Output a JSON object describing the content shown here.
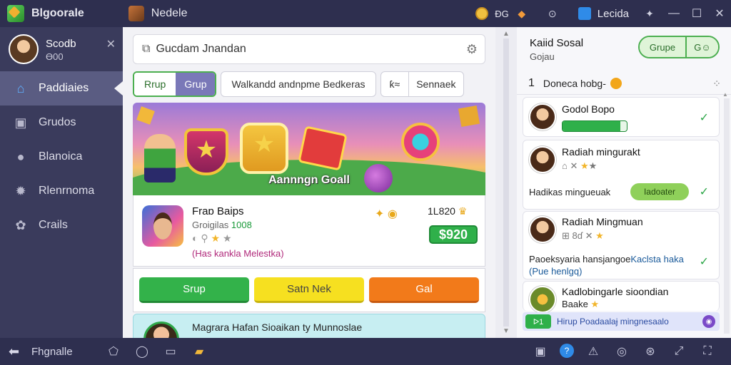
{
  "titlebar": {
    "app_title": "Blgoorale",
    "tab_title": "Nedele",
    "coin_text": "ÐG",
    "tab2_title": "Lecida",
    "icons": [
      "coin-icon",
      "diamond-icon",
      "settings-icon",
      "blue-square-icon",
      "puzzle-icon",
      "minimize-icon",
      "maximize-icon",
      "close-icon"
    ]
  },
  "sidebar": {
    "profile_name": "Scodb",
    "profile_sub": "Ɵ00",
    "items": [
      {
        "label": "Paddiaies",
        "icon": "home-icon",
        "active": true
      },
      {
        "label": "Grudos",
        "icon": "gallery-icon",
        "active": false
      },
      {
        "label": "Blanoica",
        "icon": "chat-icon",
        "active": false
      },
      {
        "label": "Rlenrnoma",
        "icon": "gear-icon",
        "active": false
      },
      {
        "label": "Crails",
        "icon": "settings-icon",
        "active": false
      }
    ]
  },
  "main": {
    "search_value": "Gucdam Jnandan",
    "chips": {
      "pair_a": "Rrup",
      "pair_b": "Grup",
      "wide": "Walkandd andnpme Bedkeras",
      "split_icon": "ƙ≈",
      "split_text": "Sennaek"
    },
    "banner_label": "Aannngn Goall",
    "game": {
      "title": "Fraɒ Baips",
      "sub_prefix": "Groigilas ",
      "sub_value": "1008",
      "stars": [
        "off",
        "on",
        "on"
      ],
      "note": "(Has kankla Melestka)",
      "count": "1L820",
      "price": "$920"
    },
    "actions": {
      "green": "Srup",
      "yellow": "Satn Nek",
      "orange": "Gal"
    },
    "promo_text": "Magrara Hafan Sioaikan ty Munnoslae"
  },
  "right": {
    "title": "Kaiid Sosal",
    "sub": "Gojau",
    "group_a": "Grupe",
    "group_b": "G",
    "head_num": "1",
    "head_text": "Doneca hobg-",
    "items": [
      {
        "name": "Godol Bopo",
        "progress": 0.9
      },
      {
        "name": "Radiah mingurakt",
        "meta": "⌂ ✕",
        "text": "Hadikas mingueuak",
        "pill": "Iadoater"
      },
      {
        "name": "Radiah Mingmuan",
        "meta": "⊞ 8ɗ ✕",
        "text_a": "Paoeksyaria hansjangoe",
        "text_b": "Kaclsta haka",
        "text_c": "(Pue henlgq)"
      },
      {
        "name": "Kadlobingarle sioondian",
        "sub": "Baake"
      }
    ],
    "footer": "Hirup Poadaalaɉ mingnesaalo",
    "footer_tag": "ᐅ1"
  },
  "taskbar": {
    "back_label": "Fhgnalle"
  }
}
